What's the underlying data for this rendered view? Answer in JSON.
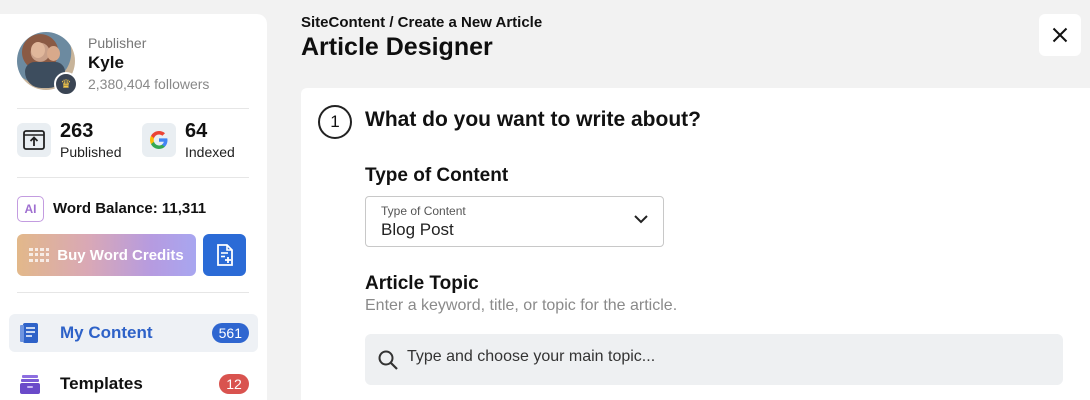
{
  "profile": {
    "role": "Publisher",
    "name": "Kyle",
    "followers": "2,380,404 followers",
    "badge_icon": "crown-icon"
  },
  "stats": [
    {
      "value": "263",
      "label": "Published",
      "icon": "upload-screen-icon"
    },
    {
      "value": "64",
      "label": "Indexed",
      "icon": "google-icon"
    }
  ],
  "words": {
    "ai_label": "AI",
    "balance": "Word Balance: 11,311",
    "buy_label": "Buy Word Credits"
  },
  "nav": [
    {
      "label": "My Content",
      "count": "561",
      "count_color": "#2f66d0",
      "icon": "document-stack-icon"
    },
    {
      "label": "Templates",
      "count": "12",
      "count_color": "#d9534f",
      "icon": "templates-tray-icon"
    }
  ],
  "header": {
    "breadcrumb": "SiteContent / Create a New Article",
    "title": "Article Designer"
  },
  "step": {
    "number": "1",
    "question": "What do you want to write about?"
  },
  "content_type": {
    "title": "Type of Content",
    "floating_label": "Type of Content",
    "value": "Blog Post"
  },
  "topic": {
    "title": "Article Topic",
    "hint": "Enter a keyword, title, or topic for the article.",
    "placeholder": "Type and choose your main topic..."
  },
  "colors": {
    "accent": "#2e62c8",
    "badge_blue": "#2f66d0",
    "badge_red": "#d9534f"
  }
}
